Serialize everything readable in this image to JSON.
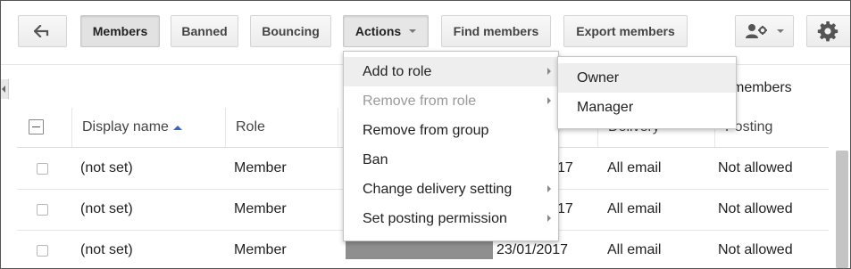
{
  "toolbar": {
    "back_label": "",
    "members_label": "Members",
    "banned_label": "Banned",
    "bouncing_label": "Bouncing",
    "actions_label": "Actions",
    "find_members_label": "Find members",
    "export_members_label": "Export members"
  },
  "member_count_label": "members",
  "table": {
    "columns": [
      "Display name",
      "Role",
      "Delivery",
      "Posting"
    ],
    "rows": [
      {
        "display_name": "(not set)",
        "role": "Member",
        "joined": "17",
        "delivery": "All email",
        "posting": "Not allowed"
      },
      {
        "display_name": "(not set)",
        "role": "Member",
        "joined": "17",
        "delivery": "All email",
        "posting": "Not allowed"
      },
      {
        "display_name": "(not set)",
        "role": "Member",
        "joined": "23/01/2017",
        "delivery": "All email",
        "posting": "Not allowed"
      }
    ]
  },
  "actions_menu": {
    "items": [
      {
        "label": "Add to role",
        "has_submenu": true,
        "disabled": false
      },
      {
        "label": "Remove from role",
        "has_submenu": true,
        "disabled": true
      },
      {
        "label": "Remove from group",
        "has_submenu": false,
        "disabled": false
      },
      {
        "label": "Ban",
        "has_submenu": false,
        "disabled": false
      },
      {
        "label": "Change delivery setting",
        "has_submenu": true,
        "disabled": false
      },
      {
        "label": "Set posting permission",
        "has_submenu": true,
        "disabled": false
      }
    ]
  },
  "role_submenu": {
    "items": [
      {
        "label": "Owner"
      },
      {
        "label": "Manager"
      }
    ]
  },
  "icons": {
    "back": "arrow-left-icon",
    "add_member": "person-add-icon",
    "settings": "gear-icon"
  },
  "colors": {
    "sort_indicator": "#3366cc",
    "menu_hover": "#eeeeee",
    "disabled_text": "#999999"
  }
}
